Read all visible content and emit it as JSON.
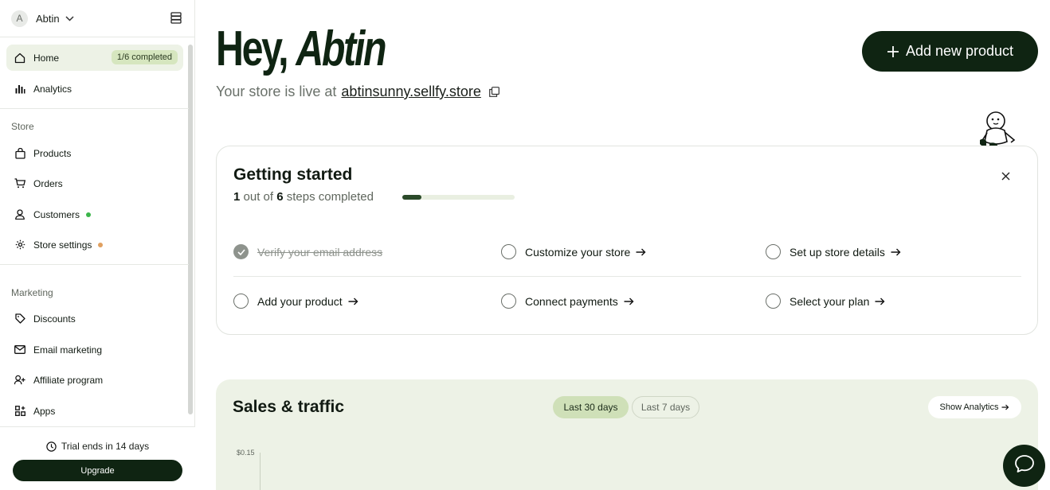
{
  "account": {
    "initial": "A",
    "name": "Abtin"
  },
  "sidebar": {
    "home": {
      "label": "Home",
      "badge": "1/6 completed"
    },
    "analytics": {
      "label": "Analytics"
    },
    "store_section": "Store",
    "products": {
      "label": "Products"
    },
    "orders": {
      "label": "Orders"
    },
    "customers": {
      "label": "Customers",
      "dot_color": "#3bb54a"
    },
    "store_settings": {
      "label": "Store settings",
      "dot_color": "#e0a060"
    },
    "marketing_section": "Marketing",
    "discounts": {
      "label": "Discounts"
    },
    "email_marketing": {
      "label": "Email marketing"
    },
    "affiliate": {
      "label": "Affiliate program"
    },
    "apps": {
      "label": "Apps"
    },
    "trial": "Trial ends in 14 days",
    "upgrade": "Upgrade"
  },
  "header": {
    "greeting": "Hey,",
    "name": "Abtin",
    "live_prefix": "Your store is live at",
    "store_url": "abtinsunny.sellfy.store",
    "add_product": "Add new product"
  },
  "getting_started": {
    "title": "Getting started",
    "done_count": "1",
    "out_of": "out of",
    "total": "6",
    "steps_completed": "steps completed",
    "progress_fraction": 0.17,
    "steps": [
      {
        "label": "Verify your email address",
        "done": true
      },
      {
        "label": "Customize your store",
        "done": false
      },
      {
        "label": "Set up store details",
        "done": false
      },
      {
        "label": "Add your product",
        "done": false
      },
      {
        "label": "Connect payments",
        "done": false
      },
      {
        "label": "Select your plan",
        "done": false
      }
    ]
  },
  "sales": {
    "title": "Sales & traffic",
    "range_active": "Last 30 days",
    "range_other": "Last 7 days",
    "show_analytics": "Show Analytics",
    "y_tick": "$0.15"
  },
  "colors": {
    "brand_dark": "#0f2412",
    "accent_light": "#edf2e6",
    "badge_bg": "#d6e6bf"
  }
}
